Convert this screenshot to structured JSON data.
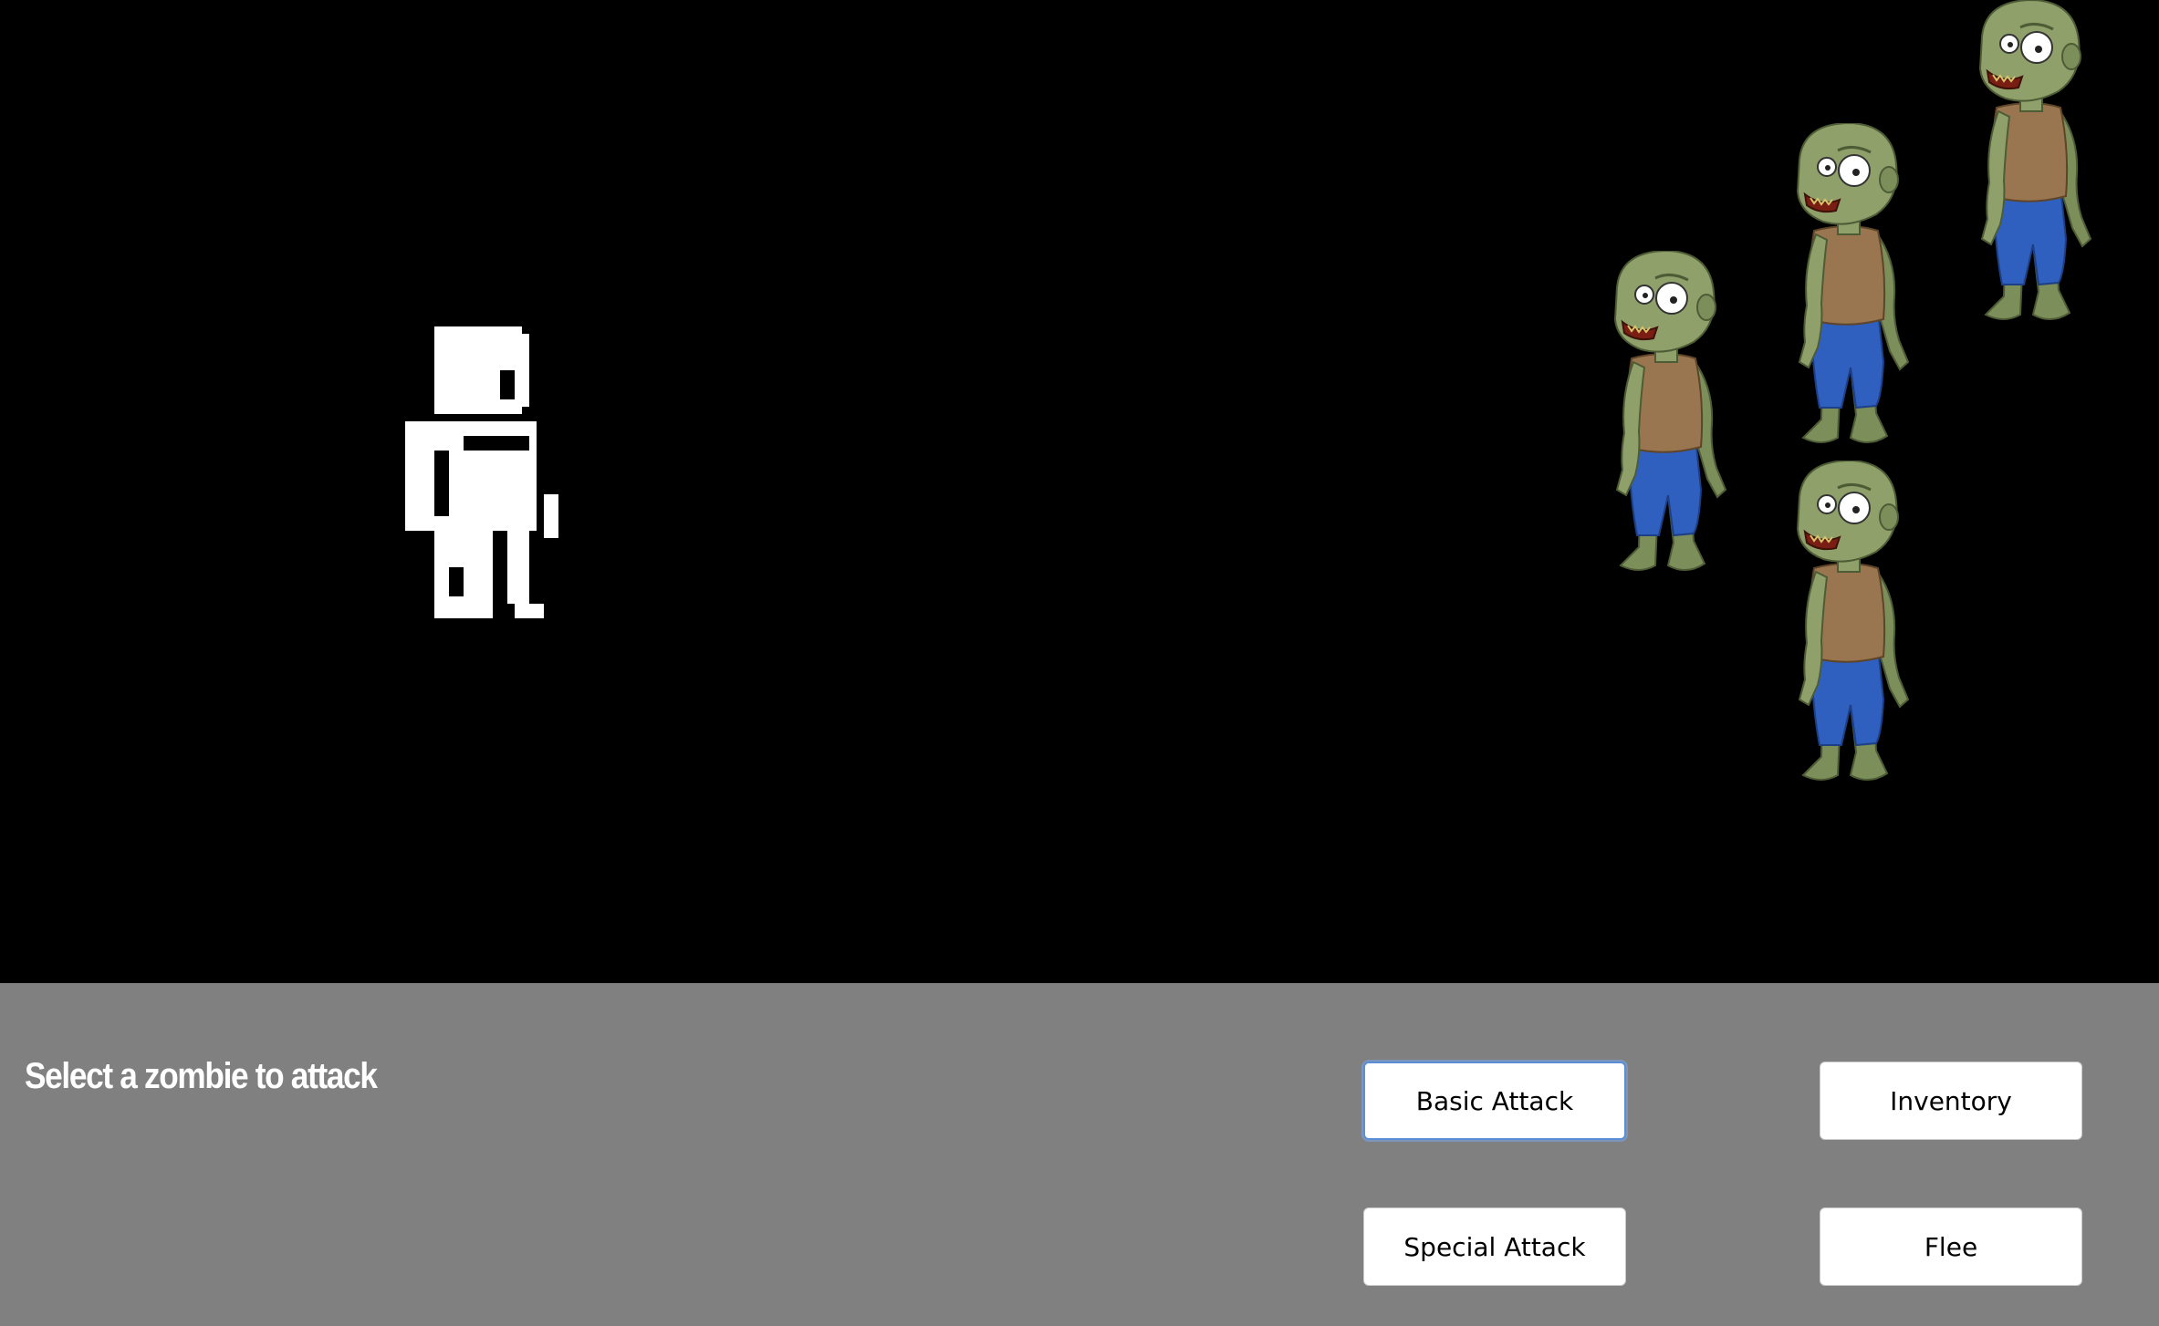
{
  "panel": {
    "prompt": "Select a zombie to attack"
  },
  "actions": {
    "basic_attack": "Basic Attack",
    "inventory": "Inventory",
    "special_attack": "Special Attack",
    "flee": "Flee"
  },
  "colors": {
    "arena_background": "#000000",
    "panel_background": "#808080",
    "button_background": "#ffffff",
    "focus_ring": "#5a8fd8",
    "zombie_skin": "#8fa06a",
    "zombie_shirt": "#9a7650",
    "zombie_pants": "#2f5fbf"
  },
  "sprites": {
    "player": "pixel-art-player-icon",
    "enemies": [
      "zombie",
      "zombie",
      "zombie",
      "zombie"
    ]
  }
}
